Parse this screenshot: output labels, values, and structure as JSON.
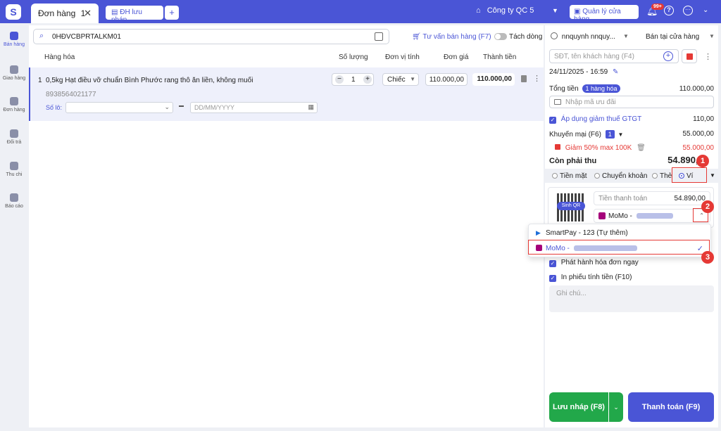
{
  "tabs": {
    "active_label": "Đơn hàng",
    "active_num": "1",
    "close": "✕",
    "draft_label": "ĐH lưu nháp",
    "add": "+"
  },
  "topbar": {
    "company": "Công ty QC 5",
    "store_mgmt": "Quản lý cửa hàng",
    "notif_badge": "99+"
  },
  "sidebar": {
    "items": [
      {
        "label": "Bán hàng"
      },
      {
        "label": "Giao hàng"
      },
      {
        "label": "Đơn hàng"
      },
      {
        "label": "Đổi trả"
      },
      {
        "label": "Thu chi"
      },
      {
        "label": "Báo cáo"
      }
    ]
  },
  "order": {
    "search_value": "0HĐVCBPRTALKM01",
    "advise": "Tư vấn bán hàng (F7)",
    "split": "Tách dòng",
    "columns": {
      "item": "Hàng hóa",
      "qty": "Số lượng",
      "unit": "Đơn vị tính",
      "price": "Đơn giá",
      "total": "Thành tiền"
    },
    "row": {
      "num": "1",
      "name": "0,5kg Hạt điều vỡ chuẩn Bình Phước rang thô ăn liền, không muối",
      "sku": "8938564021177",
      "lot_label": "Số lô:",
      "date_placeholder": "DD/MM/YYYY",
      "qty": "1",
      "unit": "Chiếc",
      "price": "110.000,00",
      "total": "110.000,00"
    }
  },
  "panel": {
    "user": "nnquynh nnquy...",
    "mode": "Bán tại cửa hàng",
    "customer_placeholder": "SĐT, tên khách hàng (F4)",
    "timestamp": "24/11/2025 - 16:59",
    "total_label": "Tổng tiền",
    "total_count": "1 hàng hóa",
    "total_value": "110.000,00",
    "promo_placeholder": "Nhập mã ưu đãi",
    "vat_label": "Áp dụng giảm thuế GTGT",
    "vat_value": "110,00",
    "discount_label": "Khuyến mại (F6)",
    "discount_count": "1",
    "discount_value": "55.000,00",
    "discount_item": "Giảm 50% max 100K",
    "discount_item_value": "55.000,00",
    "due_label": "Còn phải thu",
    "due_value": "54.890,00",
    "methods": [
      "Tiền mặt",
      "Chuyển khoản",
      "Thẻ",
      "Ví"
    ],
    "qr_label": "Sinh QR",
    "amount_label": "Tiền thanh toán",
    "amount_value": "54.890,00",
    "wallet_selected": "MoMo -",
    "publish_invoice": "Phát hành hóa đơn ngay",
    "print_receipt": "In phiếu tính tiền (F10)",
    "note_placeholder": "Ghi chú...",
    "save_draft": "Lưu nháp (F8)",
    "checkout": "Thanh toán (F9)"
  },
  "dropdown": {
    "options": [
      {
        "label": "SmartPay - 123 (Tự thêm)"
      },
      {
        "label": "MoMo -"
      }
    ]
  },
  "steps": [
    "1",
    "2",
    "3"
  ],
  "colors": {
    "primary": "#4a55d6",
    "success": "#22a84a",
    "danger": "#e53935"
  }
}
